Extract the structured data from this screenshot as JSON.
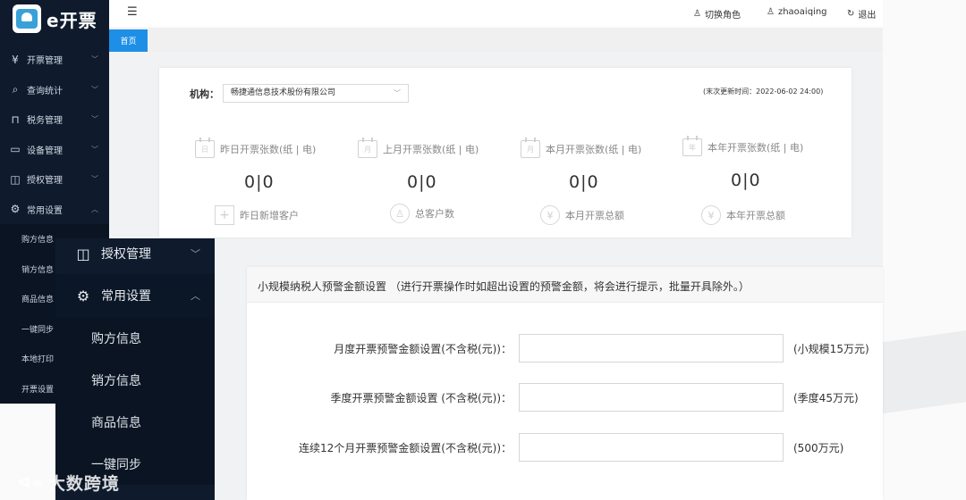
{
  "app": {
    "logo_text": "e开票"
  },
  "sidebar": {
    "items": [
      {
        "label": "开票管理",
        "icon": "invoice-icon"
      },
      {
        "label": "查询统计",
        "icon": "search-icon"
      },
      {
        "label": "税务管理",
        "icon": "tax-icon"
      },
      {
        "label": "设备管理",
        "icon": "device-icon"
      },
      {
        "label": "授权管理",
        "icon": "authorize-icon"
      },
      {
        "label": "常用设置",
        "icon": "gear-icon"
      }
    ],
    "sub_items": [
      "购方信息",
      "销方信息",
      "商品信息",
      "一键同步",
      "本地打印",
      "开票设置"
    ]
  },
  "header": {
    "switch_role": "切换角色",
    "username": "zhaoaiqing",
    "logout": "退出"
  },
  "tabs": [
    {
      "label": "首页"
    }
  ],
  "dashboard": {
    "org_label": "机构：",
    "org_value": "畅捷通信息技术股份有限公司",
    "update_time": "(末次更新时间：2022-06-02 24:00)",
    "stats": [
      {
        "label": "昨日开票张数(纸 | 电)",
        "value": "0|0",
        "icon_text": "日"
      },
      {
        "label": "上月开票张数(纸 | 电)",
        "value": "0|0",
        "icon_text": "月"
      },
      {
        "label": "本月开票张数(纸 | 电)",
        "value": "0|0",
        "icon_text": "月"
      },
      {
        "label": "本年开票张数(纸 | 电)",
        "value": "0|0",
        "icon_text": "年"
      }
    ],
    "stats2": [
      {
        "label": "昨日新增客户"
      },
      {
        "label": "总客户数"
      },
      {
        "label": "本月开票总额"
      },
      {
        "label": "本年开票总额"
      }
    ]
  },
  "warning": {
    "title": "小规模纳税人预警金额设置  （进行开票操作时如超出设置的预警金额，将会进行提示，批量开具除外。）",
    "fields": [
      {
        "label": "月度开票预警金额设置(不含税(元))：",
        "value": "",
        "hint": "(小规模15万元)"
      },
      {
        "label": "季度开票预警金额设置 (不含税(元))：",
        "value": "",
        "hint": "(季度45万元)"
      },
      {
        "label": "连续12个月开票预警金额设置(不含税(元))：",
        "value": "",
        "hint": "(500万元)"
      }
    ]
  },
  "overlay": {
    "items": [
      {
        "label": "授权管理"
      },
      {
        "label": "常用设置"
      }
    ],
    "sub_items": [
      "购方信息",
      "销方信息",
      "商品信息",
      "一键同步"
    ]
  },
  "watermark": "大数跨境"
}
